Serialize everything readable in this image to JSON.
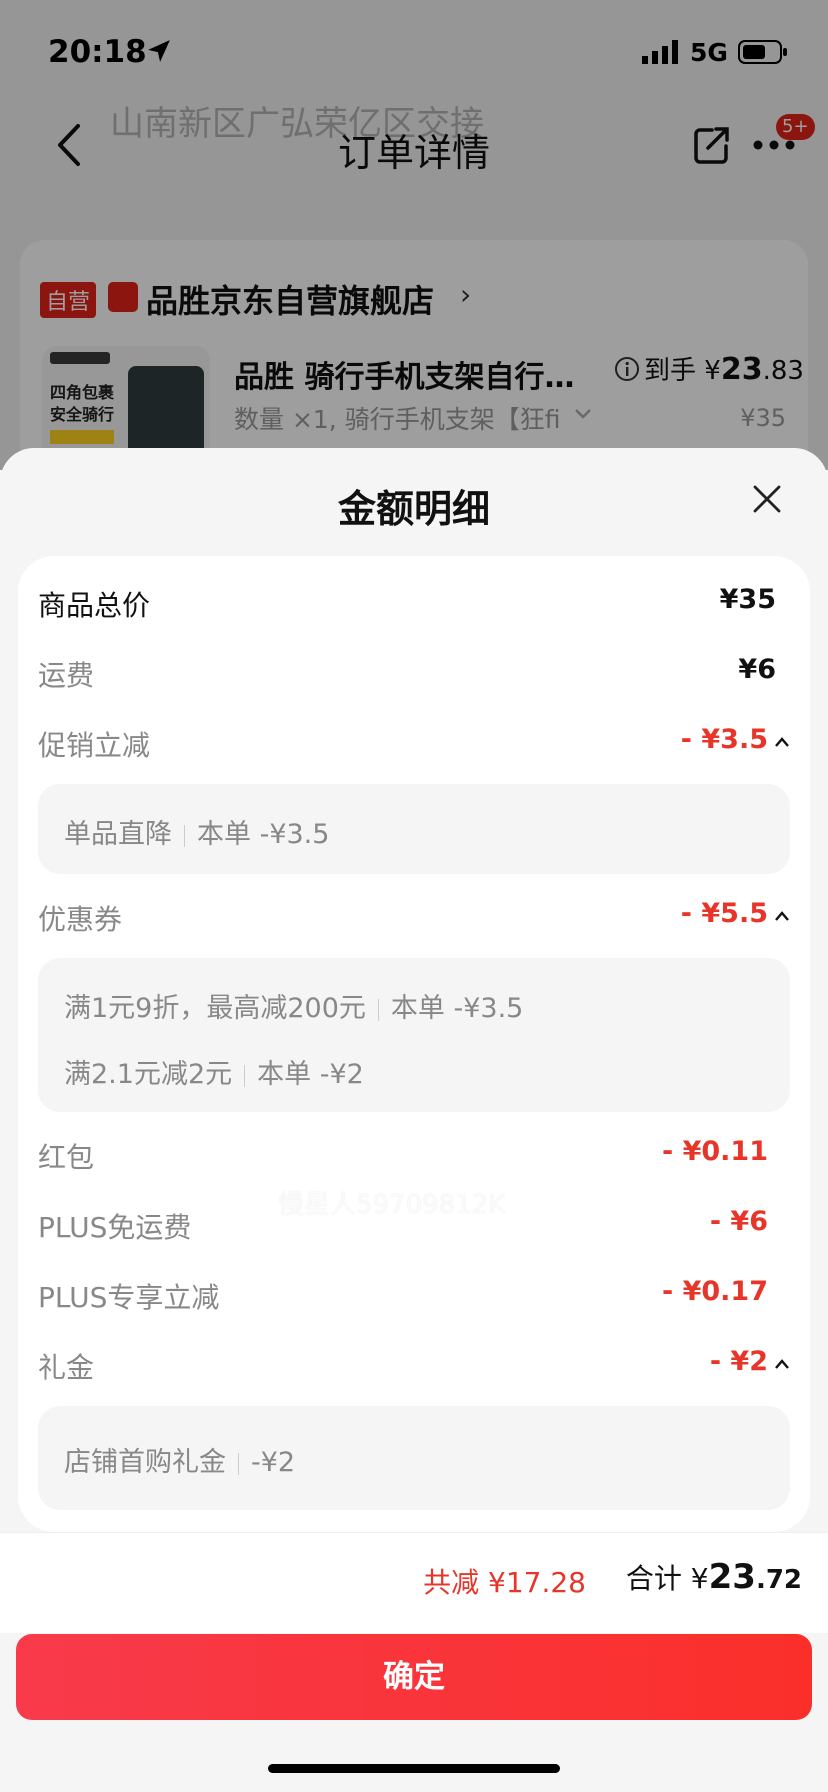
{
  "status_bar": {
    "time": "20:18",
    "network": "5G"
  },
  "background": {
    "ghost_line_1": "山南新区广弘荣亿区交接",
    "nav_title": "订单详情",
    "more_badge": "5+",
    "shop": {
      "self_tag": "自营",
      "name": "品胜京东自营旗舰店",
      "product_title": "品胜 骑行手机支架自行…",
      "price_label": "到手",
      "price_currency": "¥",
      "price_int": "23",
      "price_dec": ".83",
      "spec": "数量 ×1, 骑行手机支架【狂fi",
      "original_price": "¥35",
      "image_text": "四角包裹 安全骑行"
    }
  },
  "sheet": {
    "title": "金额明细",
    "rows": {
      "goods_total": {
        "label": "商品总价",
        "value": "¥35"
      },
      "shipping": {
        "label": "运费",
        "value": "¥6"
      },
      "promo": {
        "label": "促销立减",
        "value": "- ¥3.5"
      },
      "promo_detail": {
        "name": "单品直降",
        "amount": "本单 -¥3.5"
      },
      "coupon": {
        "label": "优惠券",
        "value": "- ¥5.5"
      },
      "coupon_detail_1": {
        "name": "满1元9折，最高减200元",
        "amount": "本单 -¥3.5"
      },
      "coupon_detail_2": {
        "name": "满2.1元减2元",
        "amount": "本单 -¥2"
      },
      "red_packet": {
        "label": "红包",
        "value": "- ¥0.11"
      },
      "plus_free_shipping": {
        "label": "PLUS免运费",
        "value": "- ¥6"
      },
      "plus_discount": {
        "label": "PLUS专享立减",
        "value": "- ¥0.17"
      },
      "gift": {
        "label": "礼金",
        "value": "- ¥2"
      },
      "gift_detail": {
        "name": "店铺首购礼金",
        "amount": "-¥2"
      }
    },
    "watermark": "慢星人59709812K"
  },
  "footer": {
    "savings": "共减 ¥17.28",
    "total_label": "合计",
    "total_currency": "¥",
    "total_int": "23",
    "total_dec": ".72",
    "confirm": "确定"
  },
  "colors": {
    "accent_red": "#e8352a",
    "button_gradient_start": "#f83a4b",
    "button_gradient_end": "#fa2f2a"
  }
}
